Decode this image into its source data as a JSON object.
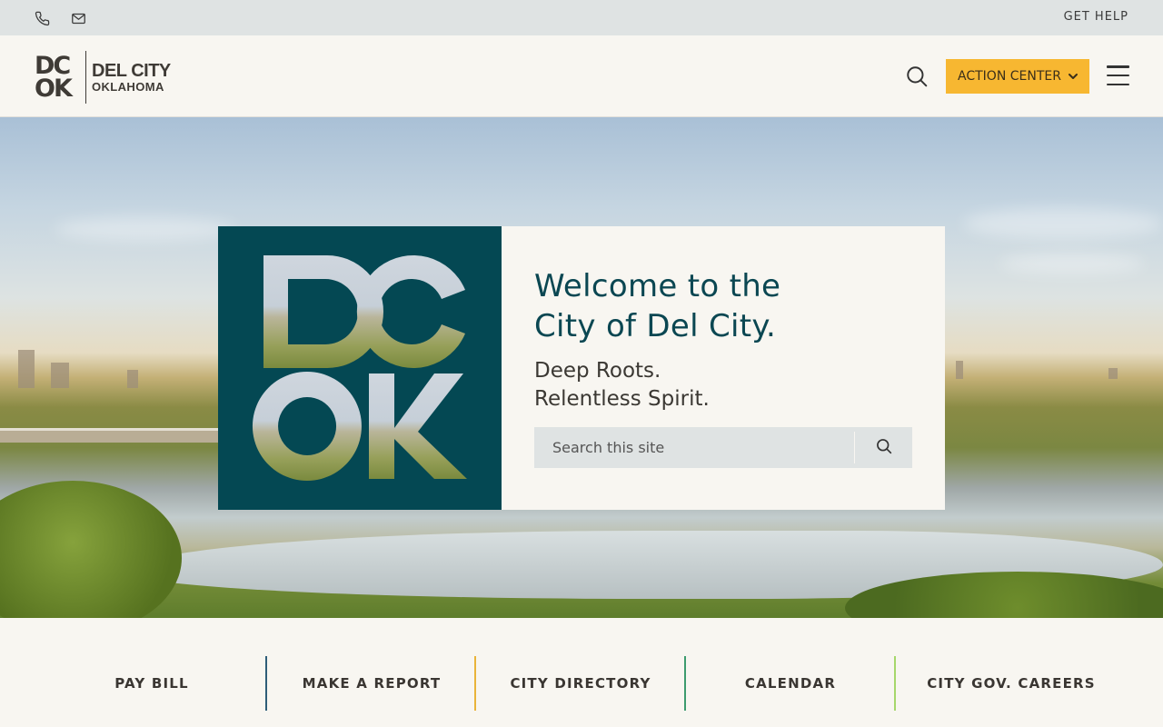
{
  "utility_bar": {
    "phone_icon": "phone-icon",
    "email_icon": "mail-icon",
    "get_help": "GET HELP"
  },
  "header": {
    "logo": {
      "mark_line1": "DC",
      "mark_line2": "OK",
      "city": "DEL CITY",
      "state": "OKLAHOMA"
    },
    "search_icon": "search-icon",
    "action_center": "ACTION CENTER",
    "menu_icon": "hamburger-icon"
  },
  "hero": {
    "tile_mark_line1": "DC",
    "tile_mark_line2": "OK",
    "heading_line1": "Welcome to the",
    "heading_line2": "City of Del City.",
    "tagline_line1": "Deep Roots.",
    "tagline_line2": "Relentless Spirit.",
    "search_placeholder": "Search this site"
  },
  "quick_links": [
    {
      "label": "PAY BILL",
      "divider_color": "#2e5d78"
    },
    {
      "label": "MAKE A REPORT",
      "divider_color": "#e9b43a"
    },
    {
      "label": "CITY DIRECTORY",
      "divider_color": "#3d9b6e"
    },
    {
      "label": "CALENDAR",
      "divider_color": "#a6d76b"
    },
    {
      "label": "CITY GOV. CAREERS",
      "divider_color": null
    }
  ],
  "colors": {
    "brand_teal": "#044853",
    "accent_yellow": "#f7b731",
    "background": "#f8f6f1"
  }
}
